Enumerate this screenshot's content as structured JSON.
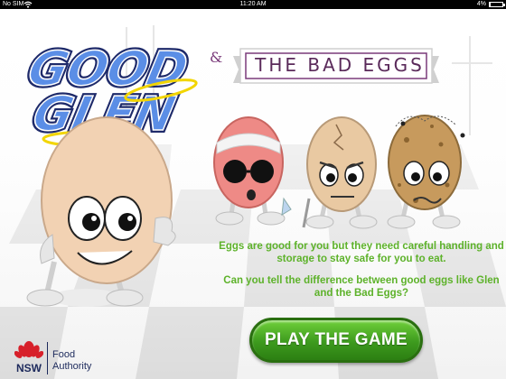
{
  "status_bar": {
    "carrier": "No SIM",
    "time": "11:20 AM",
    "battery_text": "4%",
    "battery_level": 0.04
  },
  "logo": {
    "line1": "GOOD",
    "line2": "GLEN"
  },
  "banner": {
    "ampersand": "&",
    "title": "THE BAD EGGS"
  },
  "intro": {
    "paragraph1": "Eggs are good for you but they need careful handling and storage to stay safe for you to eat.",
    "paragraph2": "Can you tell the difference between good eggs like Glen and the Bad Eggs?"
  },
  "play_button": {
    "label": "PLAY THE GAME"
  },
  "brand": {
    "nsw": "NSW",
    "food": "Food",
    "authority": "Authority"
  },
  "colors": {
    "title_purple": "#5a2a5a",
    "copy_green": "#5db22a",
    "button_green": "#3d9a1e",
    "logo_blue": "#3a5fc8",
    "halo_yellow": "#f2d500"
  }
}
